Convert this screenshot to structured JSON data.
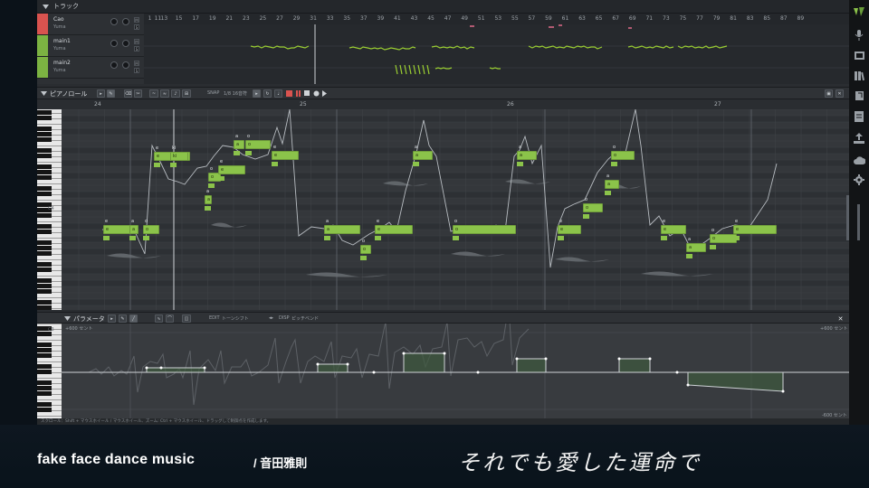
{
  "track_panel": {
    "title": "トラック",
    "tracks": [
      {
        "name": "Cao",
        "singer": "Yuma",
        "color": "#d9534f"
      },
      {
        "name": "main1",
        "singer": "Yuma",
        "color": "#7cb342"
      },
      {
        "name": "main2",
        "singer": "Yuma",
        "color": "#7cb342"
      }
    ],
    "ruler": [
      "1",
      "11",
      "13",
      "15",
      "17",
      "19",
      "21",
      "23",
      "25",
      "27",
      "29",
      "31",
      "33",
      "35",
      "37",
      "39",
      "41",
      "43",
      "45",
      "47",
      "49",
      "51",
      "53",
      "55",
      "57",
      "59",
      "61",
      "63",
      "65",
      "67",
      "69",
      "71",
      "73",
      "75",
      "77",
      "79",
      "81",
      "83",
      "85",
      "87",
      "89"
    ]
  },
  "piano_roll": {
    "title": "ピアノロール",
    "snap_label": "SNAP",
    "snap_value": "1/8 16音符",
    "ruler": [
      "24",
      "25",
      "26",
      "27"
    ],
    "key_label": "C4",
    "notes": [
      {
        "lyric": "e",
        "phoneme": "e"
      },
      {
        "lyric": "a",
        "phoneme": "a"
      },
      {
        "lyric": "o",
        "phoneme": "o"
      },
      {
        "lyric": "e",
        "phoneme": "e"
      },
      {
        "lyric": "ki",
        "phoneme": "ki"
      },
      {
        "lyric": "a",
        "phoneme": "a"
      },
      {
        "lyric": "o",
        "phoneme": "o"
      },
      {
        "lyric": "e",
        "phoneme": "e"
      },
      {
        "lyric": "a",
        "phoneme": "a"
      },
      {
        "lyric": "o",
        "phoneme": "o"
      },
      {
        "lyric": "e",
        "phoneme": "e"
      },
      {
        "lyric": "a",
        "phoneme": "a"
      },
      {
        "lyric": "o",
        "phoneme": "o"
      },
      {
        "lyric": "e",
        "phoneme": "e"
      },
      {
        "lyric": "a",
        "phoneme": "a"
      },
      {
        "lyric": "o",
        "phoneme": "o"
      },
      {
        "lyric": "a",
        "phoneme": "a"
      },
      {
        "lyric": "e",
        "phoneme": "e"
      },
      {
        "lyric": "o",
        "phoneme": "o"
      },
      {
        "lyric": "a",
        "phoneme": "a"
      },
      {
        "lyric": "o",
        "phoneme": "o"
      }
    ]
  },
  "parameter_panel": {
    "title": "パラメータ",
    "edit_label": "EDIT",
    "edit_value": "トーンシフト",
    "disp_label": "DISP",
    "disp_value": "ピッチベンド",
    "top_left": "+600 セント",
    "top_right": "+600 セント",
    "bottom_right": "-600 セント",
    "key_label": "C3",
    "status": "スクロール：Shift + マウスホイール / マウスホイール、ズーム: Ctrl + マウスホイール、ドラッグして制御点を作成します。"
  },
  "sidebar_icons": [
    "logo-icon",
    "microphone-icon",
    "film-icon",
    "library-icon",
    "document-icon",
    "export-icon",
    "cloud-icon",
    "gear-icon"
  ],
  "caption": {
    "song_title": "fake face dance music",
    "artist": "/ 音田雅則",
    "lyric": "それでも愛した運命で"
  },
  "colors": {
    "note_green": "#8bc34a",
    "track_red": "#d9534f",
    "background": "#2a2d31"
  }
}
